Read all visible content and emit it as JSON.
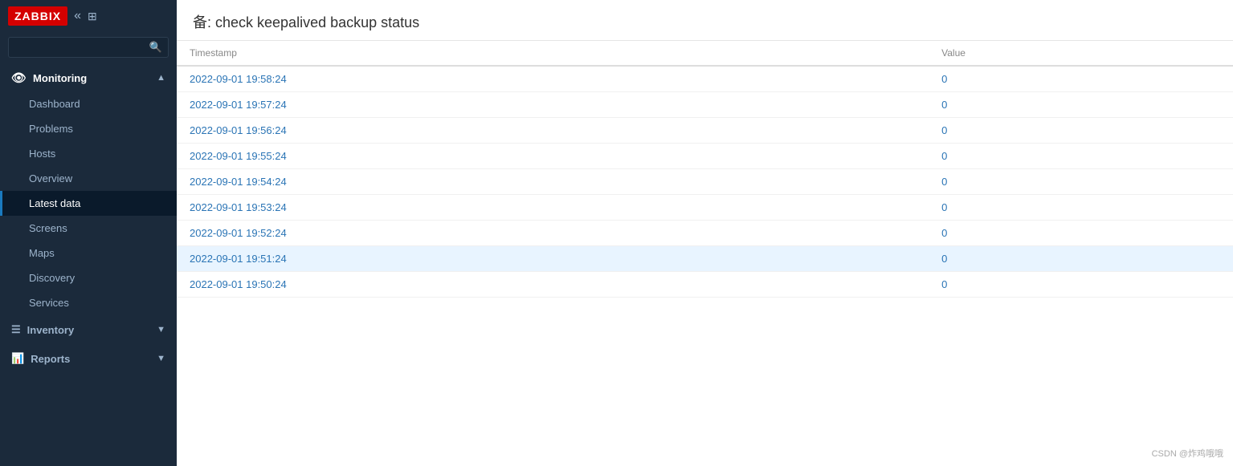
{
  "sidebar": {
    "logo": "ZABBIX",
    "search_placeholder": "",
    "sections": [
      {
        "id": "monitoring",
        "label": "Monitoring",
        "icon": "👁",
        "expanded": true,
        "items": [
          {
            "id": "dashboard",
            "label": "Dashboard",
            "active": false
          },
          {
            "id": "problems",
            "label": "Problems",
            "active": false
          },
          {
            "id": "hosts",
            "label": "Hosts",
            "active": false
          },
          {
            "id": "overview",
            "label": "Overview",
            "active": false
          },
          {
            "id": "latest-data",
            "label": "Latest data",
            "active": true
          },
          {
            "id": "screens",
            "label": "Screens",
            "active": false
          },
          {
            "id": "maps",
            "label": "Maps",
            "active": false
          },
          {
            "id": "discovery",
            "label": "Discovery",
            "active": false
          },
          {
            "id": "services",
            "label": "Services",
            "active": false
          }
        ]
      },
      {
        "id": "inventory",
        "label": "Inventory",
        "icon": "☰",
        "expanded": false,
        "items": []
      },
      {
        "id": "reports",
        "label": "Reports",
        "icon": "📊",
        "expanded": false,
        "items": []
      }
    ]
  },
  "page": {
    "title": "备: check keepalived backup status"
  },
  "table": {
    "columns": [
      {
        "id": "timestamp",
        "label": "Timestamp"
      },
      {
        "id": "value",
        "label": "Value"
      }
    ],
    "rows": [
      {
        "timestamp": "2022-09-01 19:58:24",
        "value": "0",
        "highlighted": false
      },
      {
        "timestamp": "2022-09-01 19:57:24",
        "value": "0",
        "highlighted": false
      },
      {
        "timestamp": "2022-09-01 19:56:24",
        "value": "0",
        "highlighted": false
      },
      {
        "timestamp": "2022-09-01 19:55:24",
        "value": "0",
        "highlighted": false
      },
      {
        "timestamp": "2022-09-01 19:54:24",
        "value": "0",
        "highlighted": false
      },
      {
        "timestamp": "2022-09-01 19:53:24",
        "value": "0",
        "highlighted": false
      },
      {
        "timestamp": "2022-09-01 19:52:24",
        "value": "0",
        "highlighted": false
      },
      {
        "timestamp": "2022-09-01 19:51:24",
        "value": "0",
        "highlighted": true
      },
      {
        "timestamp": "2022-09-01 19:50:24",
        "value": "0",
        "highlighted": false
      }
    ]
  },
  "watermark": "CSDN @炸鸡哦哦"
}
